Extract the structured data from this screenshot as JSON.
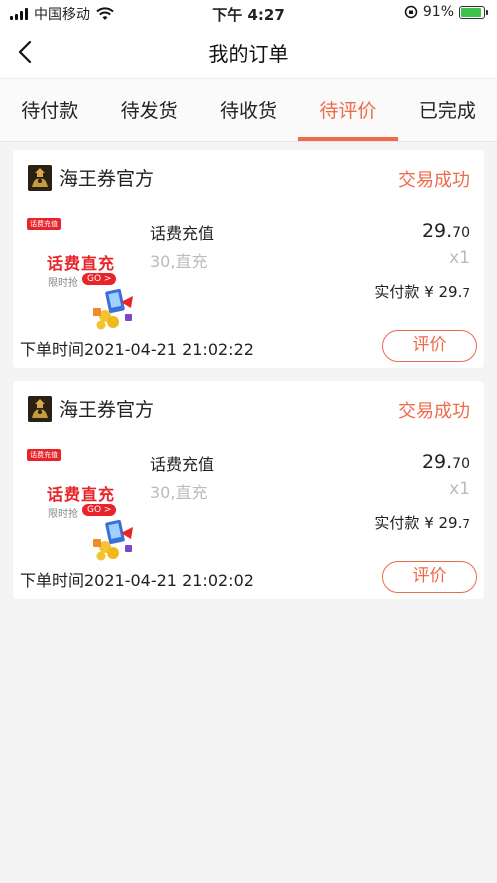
{
  "status_bar": {
    "carrier": "中国移动",
    "time": "下午 4:27",
    "battery_percent": "91%",
    "battery_level": 0.91,
    "battery_color": "#3ec24a"
  },
  "nav": {
    "back_icon": "chevron-left-icon",
    "title": "我的订单"
  },
  "tabs": [
    {
      "label": "待付款",
      "active": false
    },
    {
      "label": "待发货",
      "active": false
    },
    {
      "label": "待收货",
      "active": false
    },
    {
      "label": "待评价",
      "active": true
    },
    {
      "label": "已完成",
      "active": false
    }
  ],
  "accent_color": "#ee6a4a",
  "orders": [
    {
      "shop_name": "海王券官方",
      "status": "交易成功",
      "thumbnail": {
        "tag": "话费充值",
        "title": "话费直充",
        "sub": "限时抢",
        "go": "GO >"
      },
      "product_name": "话费充值",
      "spec": "30,直充",
      "price_main": "29.",
      "price_cents": "70",
      "quantity": "x1",
      "paid_label": "实付款 ¥ 29.",
      "paid_cents": "7",
      "order_time": "下单时间2021-04-21 21:02:22",
      "review_label": "评价"
    },
    {
      "shop_name": "海王券官方",
      "status": "交易成功",
      "thumbnail": {
        "tag": "话费充值",
        "title": "话费直充",
        "sub": "限时抢",
        "go": "GO >"
      },
      "product_name": "话费充值",
      "spec": "30,直充",
      "price_main": "29.",
      "price_cents": "70",
      "quantity": "x1",
      "paid_label": "实付款 ¥ 29.",
      "paid_cents": "7",
      "order_time": "下单时间2021-04-21 21:02:02",
      "review_label": "评价"
    }
  ]
}
